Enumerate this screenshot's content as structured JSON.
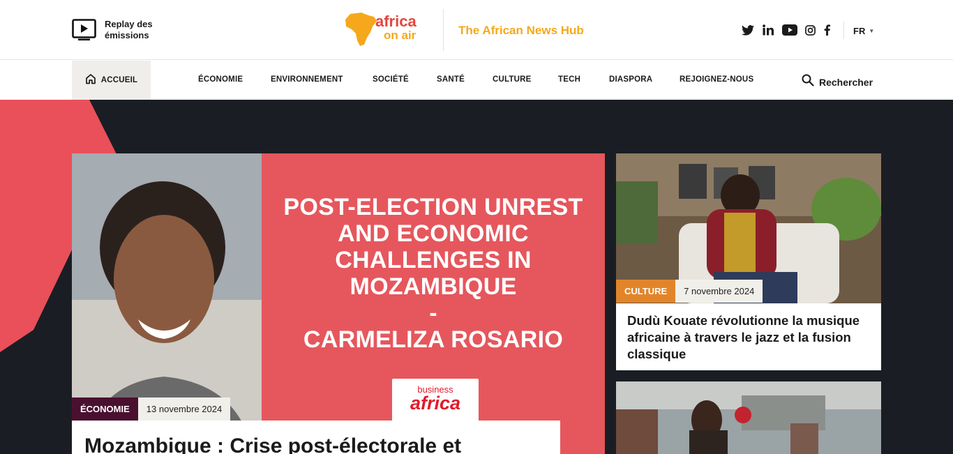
{
  "header": {
    "replay_label": "Replay des émissions",
    "replay_icon": "tv-play-icon",
    "logo_text_top": "africa",
    "logo_text_bottom": "on air",
    "tagline": "The African News Hub",
    "social": [
      "twitter-icon",
      "linkedin-icon",
      "youtube-icon",
      "instagram-icon",
      "facebook-icon"
    ],
    "language": "FR"
  },
  "nav": {
    "home": "ACCUEIL",
    "items": [
      "ÉCONOMIE",
      "ENVIRONNEMENT",
      "SOCIÉTÉ",
      "SANTÉ",
      "CULTURE",
      "TECH",
      "DIASPORA",
      "REJOIGNEZ-NOUS"
    ],
    "search": "Rechercher"
  },
  "featured": {
    "headline_image_text": "POST-ELECTION UNREST\nAND ECONOMIC\nCHALLENGES IN\nMOZAMBIQUE\n-\nCARMELIZA ROSARIO",
    "brand_small": "business",
    "brand_large": "africa",
    "category": "ÉCONOMIE",
    "date": "13 novembre 2024",
    "title": "Mozambique : Crise post-électorale et"
  },
  "side_articles": [
    {
      "category": "CULTURE",
      "date": "7 novembre 2024",
      "title": "Dudù Kouate révolutionne la musique africaine à travers le jazz et la fusion classique"
    }
  ],
  "colors": {
    "accent_orange": "#f5a81c",
    "hero_bg": "#1a1e24",
    "hero_red": "#e5575d",
    "cat_economie": "#4a1030",
    "cat_culture": "#e2852a"
  }
}
